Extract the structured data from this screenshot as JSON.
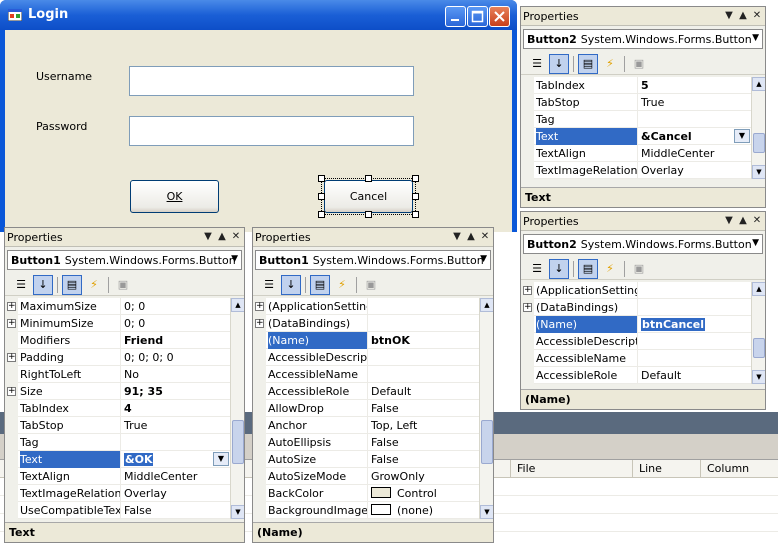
{
  "login": {
    "title": "Login",
    "username_label": "Username",
    "password_label": "Password",
    "ok_label": "OK",
    "cancel_label": "Cancel"
  },
  "ide": {
    "columns": [
      "File",
      "Line",
      "Column"
    ]
  },
  "panels": {
    "p1": {
      "title": "Properties",
      "object": "Button1",
      "type": "System.Windows.Forms.Button",
      "rows": [
        {
          "name": "MaximumSize",
          "value": "0; 0",
          "expand": true
        },
        {
          "name": "MinimumSize",
          "value": "0; 0",
          "expand": true
        },
        {
          "name": "Modifiers",
          "value": "Friend",
          "bold": true
        },
        {
          "name": "Padding",
          "value": "0; 0; 0; 0",
          "expand": true
        },
        {
          "name": "RightToLeft",
          "value": "No"
        },
        {
          "name": "Size",
          "value": "91; 35",
          "expand": true,
          "bold": true
        },
        {
          "name": "TabIndex",
          "value": "4",
          "bold": true
        },
        {
          "name": "TabStop",
          "value": "True"
        },
        {
          "name": "Tag",
          "value": ""
        },
        {
          "name": "Text",
          "value": "&OK",
          "selected": true,
          "bold": true,
          "dropdown": true,
          "highlight": true
        },
        {
          "name": "TextAlign",
          "value": "MiddleCenter"
        },
        {
          "name": "TextImageRelation",
          "value": "Overlay"
        },
        {
          "name": "UseCompatibleTextF",
          "value": "False"
        }
      ],
      "description": "Text"
    },
    "p2": {
      "title": "Properties",
      "object": "Button1",
      "type": "System.Windows.Forms.Button",
      "rows": [
        {
          "name": "(ApplicationSettings)",
          "value": "",
          "expand": true
        },
        {
          "name": "(DataBindings)",
          "value": "",
          "expand": true
        },
        {
          "name": "(Name)",
          "value": "btnOK",
          "selected": true,
          "bold": true
        },
        {
          "name": "AccessibleDescriptio",
          "value": ""
        },
        {
          "name": "AccessibleName",
          "value": ""
        },
        {
          "name": "AccessibleRole",
          "value": "Default"
        },
        {
          "name": "AllowDrop",
          "value": "False"
        },
        {
          "name": "Anchor",
          "value": "Top, Left"
        },
        {
          "name": "AutoEllipsis",
          "value": "False"
        },
        {
          "name": "AutoSize",
          "value": "False"
        },
        {
          "name": "AutoSizeMode",
          "value": "GrowOnly"
        },
        {
          "name": "BackColor",
          "value": "Control",
          "swatch": "#ece9d8"
        },
        {
          "name": "BackgroundImage",
          "value": "(none)",
          "swatch": "#ffffff"
        }
      ],
      "description": "(Name)"
    },
    "p3": {
      "title": "Properties",
      "object": "Button2",
      "type": "System.Windows.Forms.Button",
      "rows": [
        {
          "name": "TabIndex",
          "value": "5",
          "bold": true
        },
        {
          "name": "TabStop",
          "value": "True"
        },
        {
          "name": "Tag",
          "value": ""
        },
        {
          "name": "Text",
          "value": "&Cancel",
          "selected": true,
          "bold": true,
          "dropdown": true
        },
        {
          "name": "TextAlign",
          "value": "MiddleCenter"
        },
        {
          "name": "TextImageRelation",
          "value": "Overlay"
        }
      ],
      "description": "Text"
    },
    "p4": {
      "title": "Properties",
      "object": "Button2",
      "type": "System.Windows.Forms.Button",
      "rows": [
        {
          "name": "(ApplicationSettings)",
          "value": "",
          "expand": true
        },
        {
          "name": "(DataBindings)",
          "value": "",
          "expand": true
        },
        {
          "name": "(Name)",
          "value": "btnCancel",
          "selected": true,
          "bold": true,
          "highlight": true
        },
        {
          "name": "AccessibleDescriptio",
          "value": ""
        },
        {
          "name": "AccessibleName",
          "value": ""
        },
        {
          "name": "AccessibleRole",
          "value": "Default"
        }
      ],
      "description": "(Name)"
    }
  }
}
